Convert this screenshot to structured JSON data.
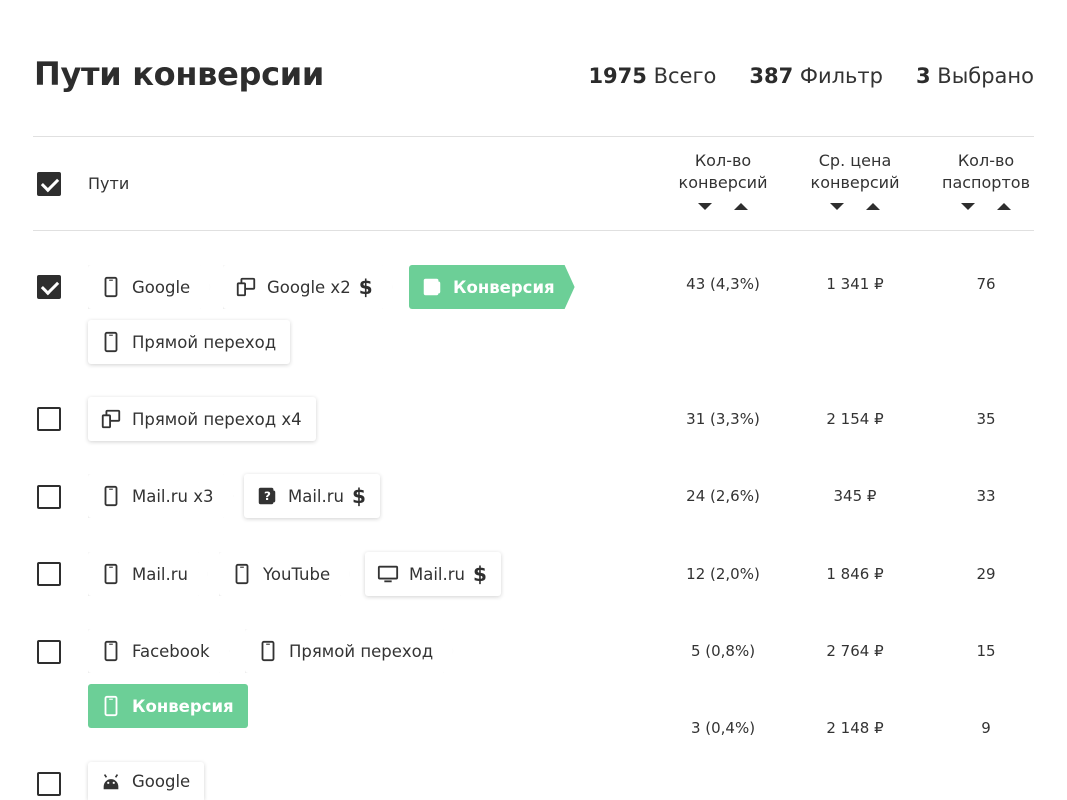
{
  "page": {
    "title": "Пути конверсии",
    "stats": {
      "total_value": "1975",
      "total_label": "Всего",
      "filter_value": "387",
      "filter_label": "Фильтр",
      "selected_value": "3",
      "selected_label": "Выбрано"
    }
  },
  "table": {
    "header": {
      "paths": "Пути",
      "col1_line1": "Кол-во",
      "col1_line2": "конверсий",
      "col2_line1": "Ср. цена",
      "col2_line2": "конверсий",
      "col3_line1": "Кол-во",
      "col3_line2": "паспортов"
    },
    "rows": [
      {
        "checked": true,
        "steps": [
          {
            "icon": "phone-icon",
            "label": "Google"
          },
          {
            "icon": "devices-icon",
            "label": "Google x2",
            "dollar": "$"
          },
          {
            "icon": "question-icon",
            "label": "Конверсия"
          },
          {
            "icon": "phone-icon",
            "label": "Прямой переход"
          }
        ],
        "conversions": "43 (4,3%)",
        "avg_price": "1 341 ₽",
        "passports": "76"
      },
      {
        "checked": false,
        "steps": [
          {
            "icon": "devices-icon",
            "label": "Прямой переход x4"
          }
        ],
        "conversions": "31 (3,3%)",
        "avg_price": "2 154 ₽",
        "passports": "35"
      },
      {
        "checked": false,
        "steps": [
          {
            "icon": "phone-icon",
            "label": "Mail.ru x3"
          },
          {
            "icon": "question-icon",
            "label": "Mail.ru",
            "dollar": "$"
          }
        ],
        "conversions": "24 (2,6%)",
        "avg_price": "345 ₽",
        "passports": "33"
      },
      {
        "checked": false,
        "steps": [
          {
            "icon": "phone-icon",
            "label": "Mail.ru"
          },
          {
            "icon": "phone-icon",
            "label": "YouTube"
          },
          {
            "icon": "monitor-icon",
            "label": "Mail.ru",
            "dollar": "$"
          }
        ],
        "conversions": "12 (2,0%)",
        "avg_price": "1 846 ₽",
        "passports": "29"
      },
      {
        "checked": false,
        "steps": [
          {
            "icon": "phone-icon",
            "label": "Facebook"
          },
          {
            "icon": "phone-icon",
            "label": "Прямой переход"
          },
          {
            "icon": "phone-icon",
            "label": "Конверсия"
          }
        ],
        "conversions": "5 (0,8%)",
        "avg_price": "2 764 ₽",
        "passports": "15"
      },
      {
        "checked": false,
        "steps": [],
        "conversions": "3 (0,4%)",
        "avg_price": "2 148 ₽",
        "passports": "9"
      },
      {
        "checked": false,
        "steps": [
          {
            "icon": "android-icon",
            "label": "Google"
          }
        ]
      }
    ]
  },
  "colors": {
    "conversion": "#6ccf97",
    "text": "#333333",
    "divider": "#e0e0e0"
  }
}
